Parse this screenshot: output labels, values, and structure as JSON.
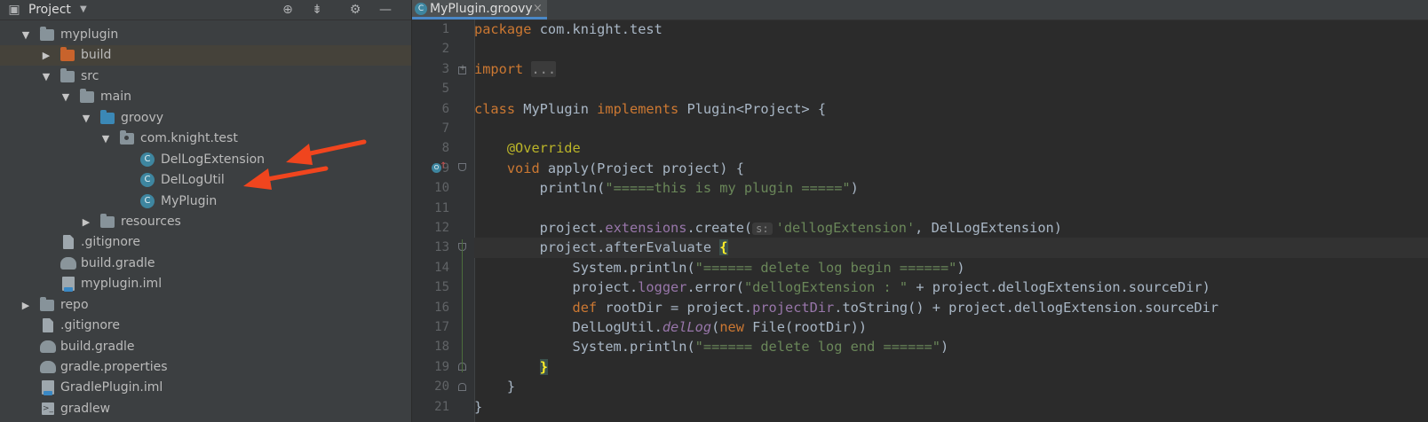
{
  "project_panel": {
    "title": "Project",
    "dropdown_icon": "chevron-down-icon",
    "toolbar_icons": [
      "project-view-icon",
      "locate-icon",
      "collapse-all-icon",
      "settings-icon",
      "hide-icon"
    ],
    "tree": [
      {
        "id": "myplugin",
        "label": "myplugin",
        "depth": 0,
        "expanded": true,
        "icon": "module-folder-icon"
      },
      {
        "id": "build",
        "label": "build",
        "depth": 1,
        "expanded": false,
        "icon": "excluded-folder-icon",
        "selected": true
      },
      {
        "id": "src",
        "label": "src",
        "depth": 1,
        "expanded": true,
        "icon": "folder-icon"
      },
      {
        "id": "main",
        "label": "main",
        "depth": 2,
        "expanded": true,
        "icon": "folder-icon"
      },
      {
        "id": "groovy",
        "label": "groovy",
        "depth": 3,
        "expanded": true,
        "icon": "source-folder-icon"
      },
      {
        "id": "pkg",
        "label": "com.knight.test",
        "depth": 4,
        "expanded": true,
        "icon": "package-icon"
      },
      {
        "id": "dellogext",
        "label": "DelLogExtension",
        "depth": 5,
        "icon": "class-icon"
      },
      {
        "id": "dellogutil",
        "label": "DelLogUtil",
        "depth": 5,
        "icon": "class-icon"
      },
      {
        "id": "myplugin-class",
        "label": "MyPlugin",
        "depth": 5,
        "icon": "class-icon"
      },
      {
        "id": "resources",
        "label": "resources",
        "depth": 3,
        "expanded": false,
        "icon": "resources-folder-icon"
      },
      {
        "id": "gitignore1",
        "label": ".gitignore",
        "depth": 2,
        "icon": "file-icon"
      },
      {
        "id": "buildgradle1",
        "label": "build.gradle",
        "depth": 2,
        "icon": "gradle-icon"
      },
      {
        "id": "mypluginiml",
        "label": "myplugin.iml",
        "depth": 2,
        "icon": "iml-icon"
      },
      {
        "id": "repo",
        "label": "repo",
        "depth": 0,
        "expanded": false,
        "icon": "folder-icon"
      },
      {
        "id": "gitignore2",
        "label": ".gitignore",
        "depth": 1,
        "icon": "file-icon"
      },
      {
        "id": "buildgradle2",
        "label": "build.gradle",
        "depth": 1,
        "icon": "gradle-icon"
      },
      {
        "id": "gradleprops",
        "label": "gradle.properties",
        "depth": 1,
        "icon": "gradle-icon"
      },
      {
        "id": "gradlepluginiml",
        "label": "GradlePlugin.iml",
        "depth": 1,
        "icon": "iml-icon"
      },
      {
        "id": "gradlew",
        "label": "gradlew",
        "depth": 1,
        "icon": "terminal-file-icon"
      }
    ]
  },
  "editor": {
    "tab": {
      "label": "MyPlugin.groovy",
      "icon": "groovy-class-icon",
      "close": "×"
    },
    "line_numbers": [
      "1",
      "2",
      "3",
      "5",
      "6",
      "7",
      "8",
      "9",
      "10",
      "11",
      "12",
      "13",
      "14",
      "15",
      "16",
      "17",
      "18",
      "19",
      "20",
      "21"
    ],
    "code_lines": [
      [
        {
          "t": "package ",
          "c": "#cc7832"
        },
        {
          "t": "com.knight.test",
          "c": "#a9b7c6"
        }
      ],
      [],
      [
        {
          "t": "import ",
          "c": "#cc7832"
        },
        {
          "t": "...",
          "c": "#8c8c8c",
          "cls": "folded"
        }
      ],
      [],
      [
        {
          "t": "class ",
          "c": "#cc7832"
        },
        {
          "t": "MyPlugin ",
          "c": "#a9b7c6"
        },
        {
          "t": "implements ",
          "c": "#cc7832"
        },
        {
          "t": "Plugin<Project> {",
          "c": "#a9b7c6"
        }
      ],
      [],
      [
        {
          "t": "    @Override",
          "c": "#bbb529"
        }
      ],
      [
        {
          "t": "    void ",
          "c": "#cc7832"
        },
        {
          "t": "apply(Project project) {",
          "c": "#a9b7c6"
        }
      ],
      [
        {
          "t": "        println(",
          "c": "#a9b7c6"
        },
        {
          "t": "\"=====this is my plugin =====\"",
          "c": "#6a8759"
        },
        {
          "t": ")",
          "c": "#a9b7c6"
        }
      ],
      [],
      [
        {
          "t": "        project.",
          "c": "#a9b7c6"
        },
        {
          "t": "extensions",
          "c": "#9876aa"
        },
        {
          "t": ".create(",
          "c": "#a9b7c6"
        },
        {
          "t": "s:",
          "c": "#8a8a8a",
          "cls": "hint"
        },
        {
          "t": "'dellogExtension'",
          "c": "#6a8759"
        },
        {
          "t": ", DelLogExtension)",
          "c": "#a9b7c6"
        }
      ],
      [
        {
          "t": "        project.afterEvaluate ",
          "c": "#a9b7c6"
        },
        {
          "t": "{",
          "c": "#ffef28",
          "cls": "brace-hl"
        }
      ],
      [
        {
          "t": "            System.println(",
          "c": "#a9b7c6"
        },
        {
          "t": "\"====== delete log begin ======\"",
          "c": "#6a8759"
        },
        {
          "t": ")",
          "c": "#a9b7c6"
        }
      ],
      [
        {
          "t": "            project.",
          "c": "#a9b7c6"
        },
        {
          "t": "logger",
          "c": "#9876aa"
        },
        {
          "t": ".error(",
          "c": "#a9b7c6"
        },
        {
          "t": "\"dellogExtension : \"",
          "c": "#6a8759"
        },
        {
          "t": " + project.dellogExtension.sourceDir)",
          "c": "#a9b7c6"
        }
      ],
      [
        {
          "t": "            def ",
          "c": "#cc7832"
        },
        {
          "t": "rootDir = project.",
          "c": "#a9b7c6"
        },
        {
          "t": "projectDir",
          "c": "#9876aa"
        },
        {
          "t": ".toString() + project.dellogExtension.sourceDir",
          "c": "#a9b7c6"
        }
      ],
      [
        {
          "t": "            DelLogUtil.",
          "c": "#a9b7c6"
        },
        {
          "t": "delLog",
          "c": "#9876aa",
          "italic": true
        },
        {
          "t": "(",
          "c": "#a9b7c6"
        },
        {
          "t": "new ",
          "c": "#cc7832"
        },
        {
          "t": "File(rootDir))",
          "c": "#a9b7c6"
        }
      ],
      [
        {
          "t": "            System.println(",
          "c": "#a9b7c6"
        },
        {
          "t": "\"====== delete log end ======\"",
          "c": "#6a8759"
        },
        {
          "t": ")",
          "c": "#a9b7c6"
        }
      ],
      [
        {
          "t": "        ",
          "c": "#a9b7c6"
        },
        {
          "t": "}",
          "c": "#ffef28",
          "cls": "brace-hl"
        }
      ],
      [
        {
          "t": "    }",
          "c": "#a9b7c6"
        }
      ],
      [
        {
          "t": "}",
          "c": "#a9b7c6"
        }
      ]
    ],
    "current_line": 13
  },
  "colors": {
    "panel_bg": "#3c3f41",
    "editor_bg": "#2b2b2b",
    "keyword": "#cc7832",
    "string": "#6a8759",
    "field": "#9876aa",
    "annotation": "#bbb529",
    "annotation_arrows": "#f0451e"
  }
}
